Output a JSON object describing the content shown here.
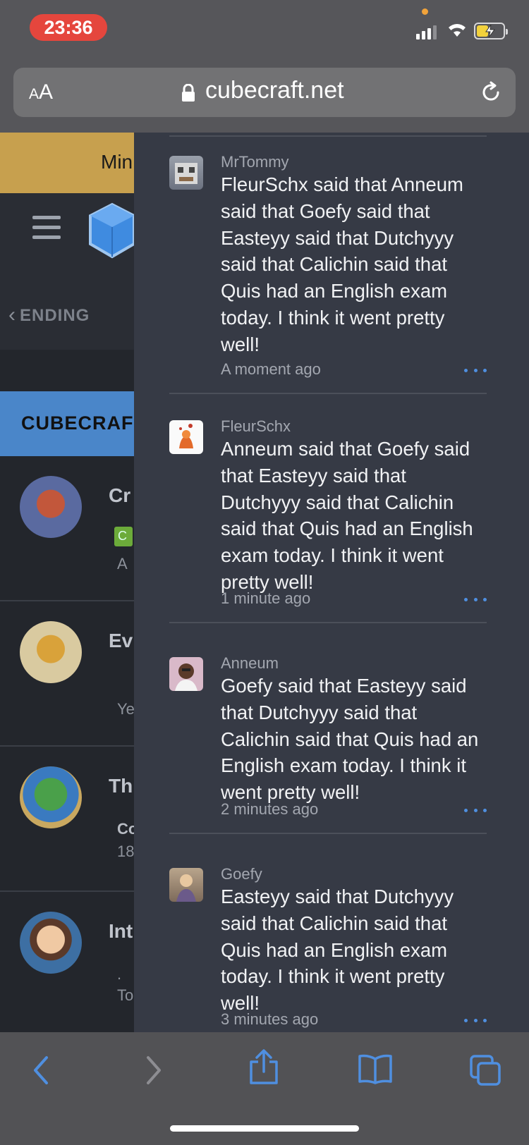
{
  "status_bar": {
    "time": "23:36"
  },
  "address_bar": {
    "text_size_label": "AA",
    "url": "cubecraft.net"
  },
  "background_page": {
    "banner_text": "Min",
    "tab_label": "ENDING",
    "section_label": "CUBECRAF",
    "rows": [
      {
        "title": "Cr",
        "badge": "C",
        "sub": "A"
      },
      {
        "title": "Ev",
        "sub": "Ye"
      },
      {
        "title": "Th",
        "sub_title": "Co",
        "sub": "18"
      },
      {
        "title": "Int",
        "sub": ".",
        "sub2": "To"
      }
    ]
  },
  "feed": [
    {
      "user": "MrTommy",
      "message": "FleurSchx said that Anneum said that Goefy said that Easteyy said that Dutchyyy said that Calichin said that Quis had an English exam today. I think it went pretty well!",
      "time": "A moment ago"
    },
    {
      "user": "FleurSchx",
      "message": "Anneum said that Goefy said that Easteyy said that Dutchyyy said that Calichin said that Quis had an English exam today. I think it went pretty well!",
      "time": "1 minute ago"
    },
    {
      "user": "Anneum",
      "message": "Goefy said that Easteyy said that Dutchyyy said that Calichin said that Quis had an English exam today. I think it went pretty well!",
      "time": "2 minutes ago"
    },
    {
      "user": "Goefy",
      "message": "Easteyy said that Dutchyyy said that Calichin said that Quis had an English exam today. I think it went pretty well!",
      "time": "3 minutes ago"
    }
  ],
  "colors": {
    "accent": "#4f8fe0",
    "panel": "#363a45",
    "time_pill": "#e5463d"
  },
  "toolbar_icons": [
    "back-icon",
    "forward-icon",
    "share-icon",
    "bookmarks-icon",
    "tabs-icon"
  ]
}
